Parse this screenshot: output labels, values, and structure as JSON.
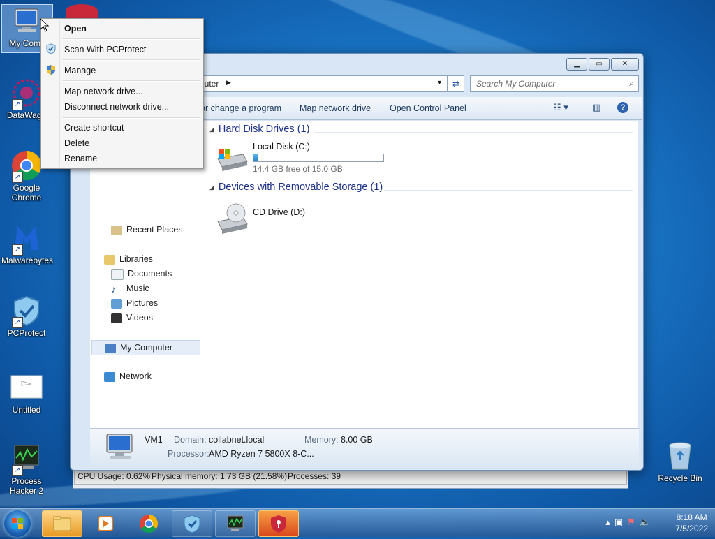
{
  "desktop": {
    "icons": [
      {
        "label": "My Comp"
      },
      {
        "label": "DataWago"
      },
      {
        "label": "Google Chrome"
      },
      {
        "label": "Malwarebytes"
      },
      {
        "label": "PCProtect"
      },
      {
        "label": "Untitled"
      },
      {
        "label": "Process Hacker 2"
      },
      {
        "label": "Recycle Bin"
      }
    ]
  },
  "context_menu": {
    "items": [
      "Open",
      "Scan With PCProtect",
      "Manage",
      "Map network drive...",
      "Disconnect network drive...",
      "Create shortcut",
      "Delete",
      "Rename"
    ]
  },
  "window": {
    "address_text": "puter",
    "search_placeholder": "Search My Computer",
    "toolbar": {
      "uninstall": "or change a program",
      "map_drive": "Map network drive",
      "control_panel": "Open Control Panel"
    },
    "nav": [
      "Recent Places",
      "Libraries",
      "Documents",
      "Music",
      "Pictures",
      "Videos",
      "My Computer",
      "Network"
    ],
    "groups": {
      "hdd": "Hard Disk Drives (1)",
      "removable": "Devices with Removable Storage (1)"
    },
    "drives": {
      "c_name": "Local Disk (C:)",
      "c_free": "14.4 GB free of 15.0 GB",
      "c_used_fraction": 0.04,
      "d_name": "CD Drive (D:)"
    },
    "details": {
      "name": "VM1",
      "domain_label": "Domain:",
      "domain": "collabnet.local",
      "memory_label": "Memory:",
      "memory": "8.00 GB",
      "processor_label": "Processor:",
      "processor": "AMD Ryzen 7 5800X 8-C..."
    }
  },
  "statusbar": {
    "cpu": "CPU Usage: 0.62%",
    "memory": "Physical memory: 1.73 GB (21.58%)",
    "processes": "Processes: 39"
  },
  "clock": {
    "time": "8:18 AM",
    "date": "7/5/2022"
  }
}
